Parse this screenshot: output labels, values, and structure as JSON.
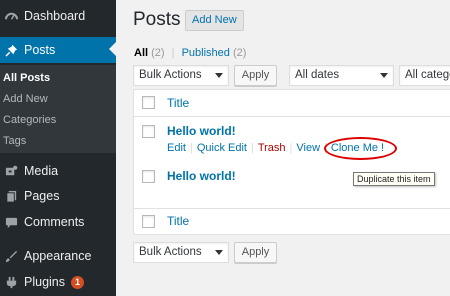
{
  "sidebar": {
    "dashboard": "Dashboard",
    "posts": "Posts",
    "submenu": [
      "All Posts",
      "Add New",
      "Categories",
      "Tags"
    ],
    "media": "Media",
    "pages": "Pages",
    "comments": "Comments",
    "appearance": "Appearance",
    "plugins": "Plugins",
    "plugins_badge": "1"
  },
  "header": {
    "title": "Posts",
    "add_new": "Add New"
  },
  "filters": {
    "all_label": "All",
    "all_count": "(2)",
    "published_label": "Published",
    "published_count": "(2)",
    "bulk_actions": "Bulk Actions",
    "apply": "Apply",
    "dates": "All dates",
    "categories": "All catego"
  },
  "table": {
    "column_title": "Title",
    "posts": [
      {
        "title": "Hello world!"
      },
      {
        "title": "Hello world!"
      }
    ],
    "row_actions": {
      "edit": "Edit",
      "quick_edit": "Quick Edit",
      "trash": "Trash",
      "view": "View",
      "clone": "Clone Me !"
    }
  },
  "tooltip": "Duplicate this item",
  "colors": {
    "sidebar_bg": "#23282d",
    "accent": "#0073aa",
    "trash": "#aa0000",
    "highlight_ring": "#dd0000",
    "badge": "#d54e21"
  }
}
